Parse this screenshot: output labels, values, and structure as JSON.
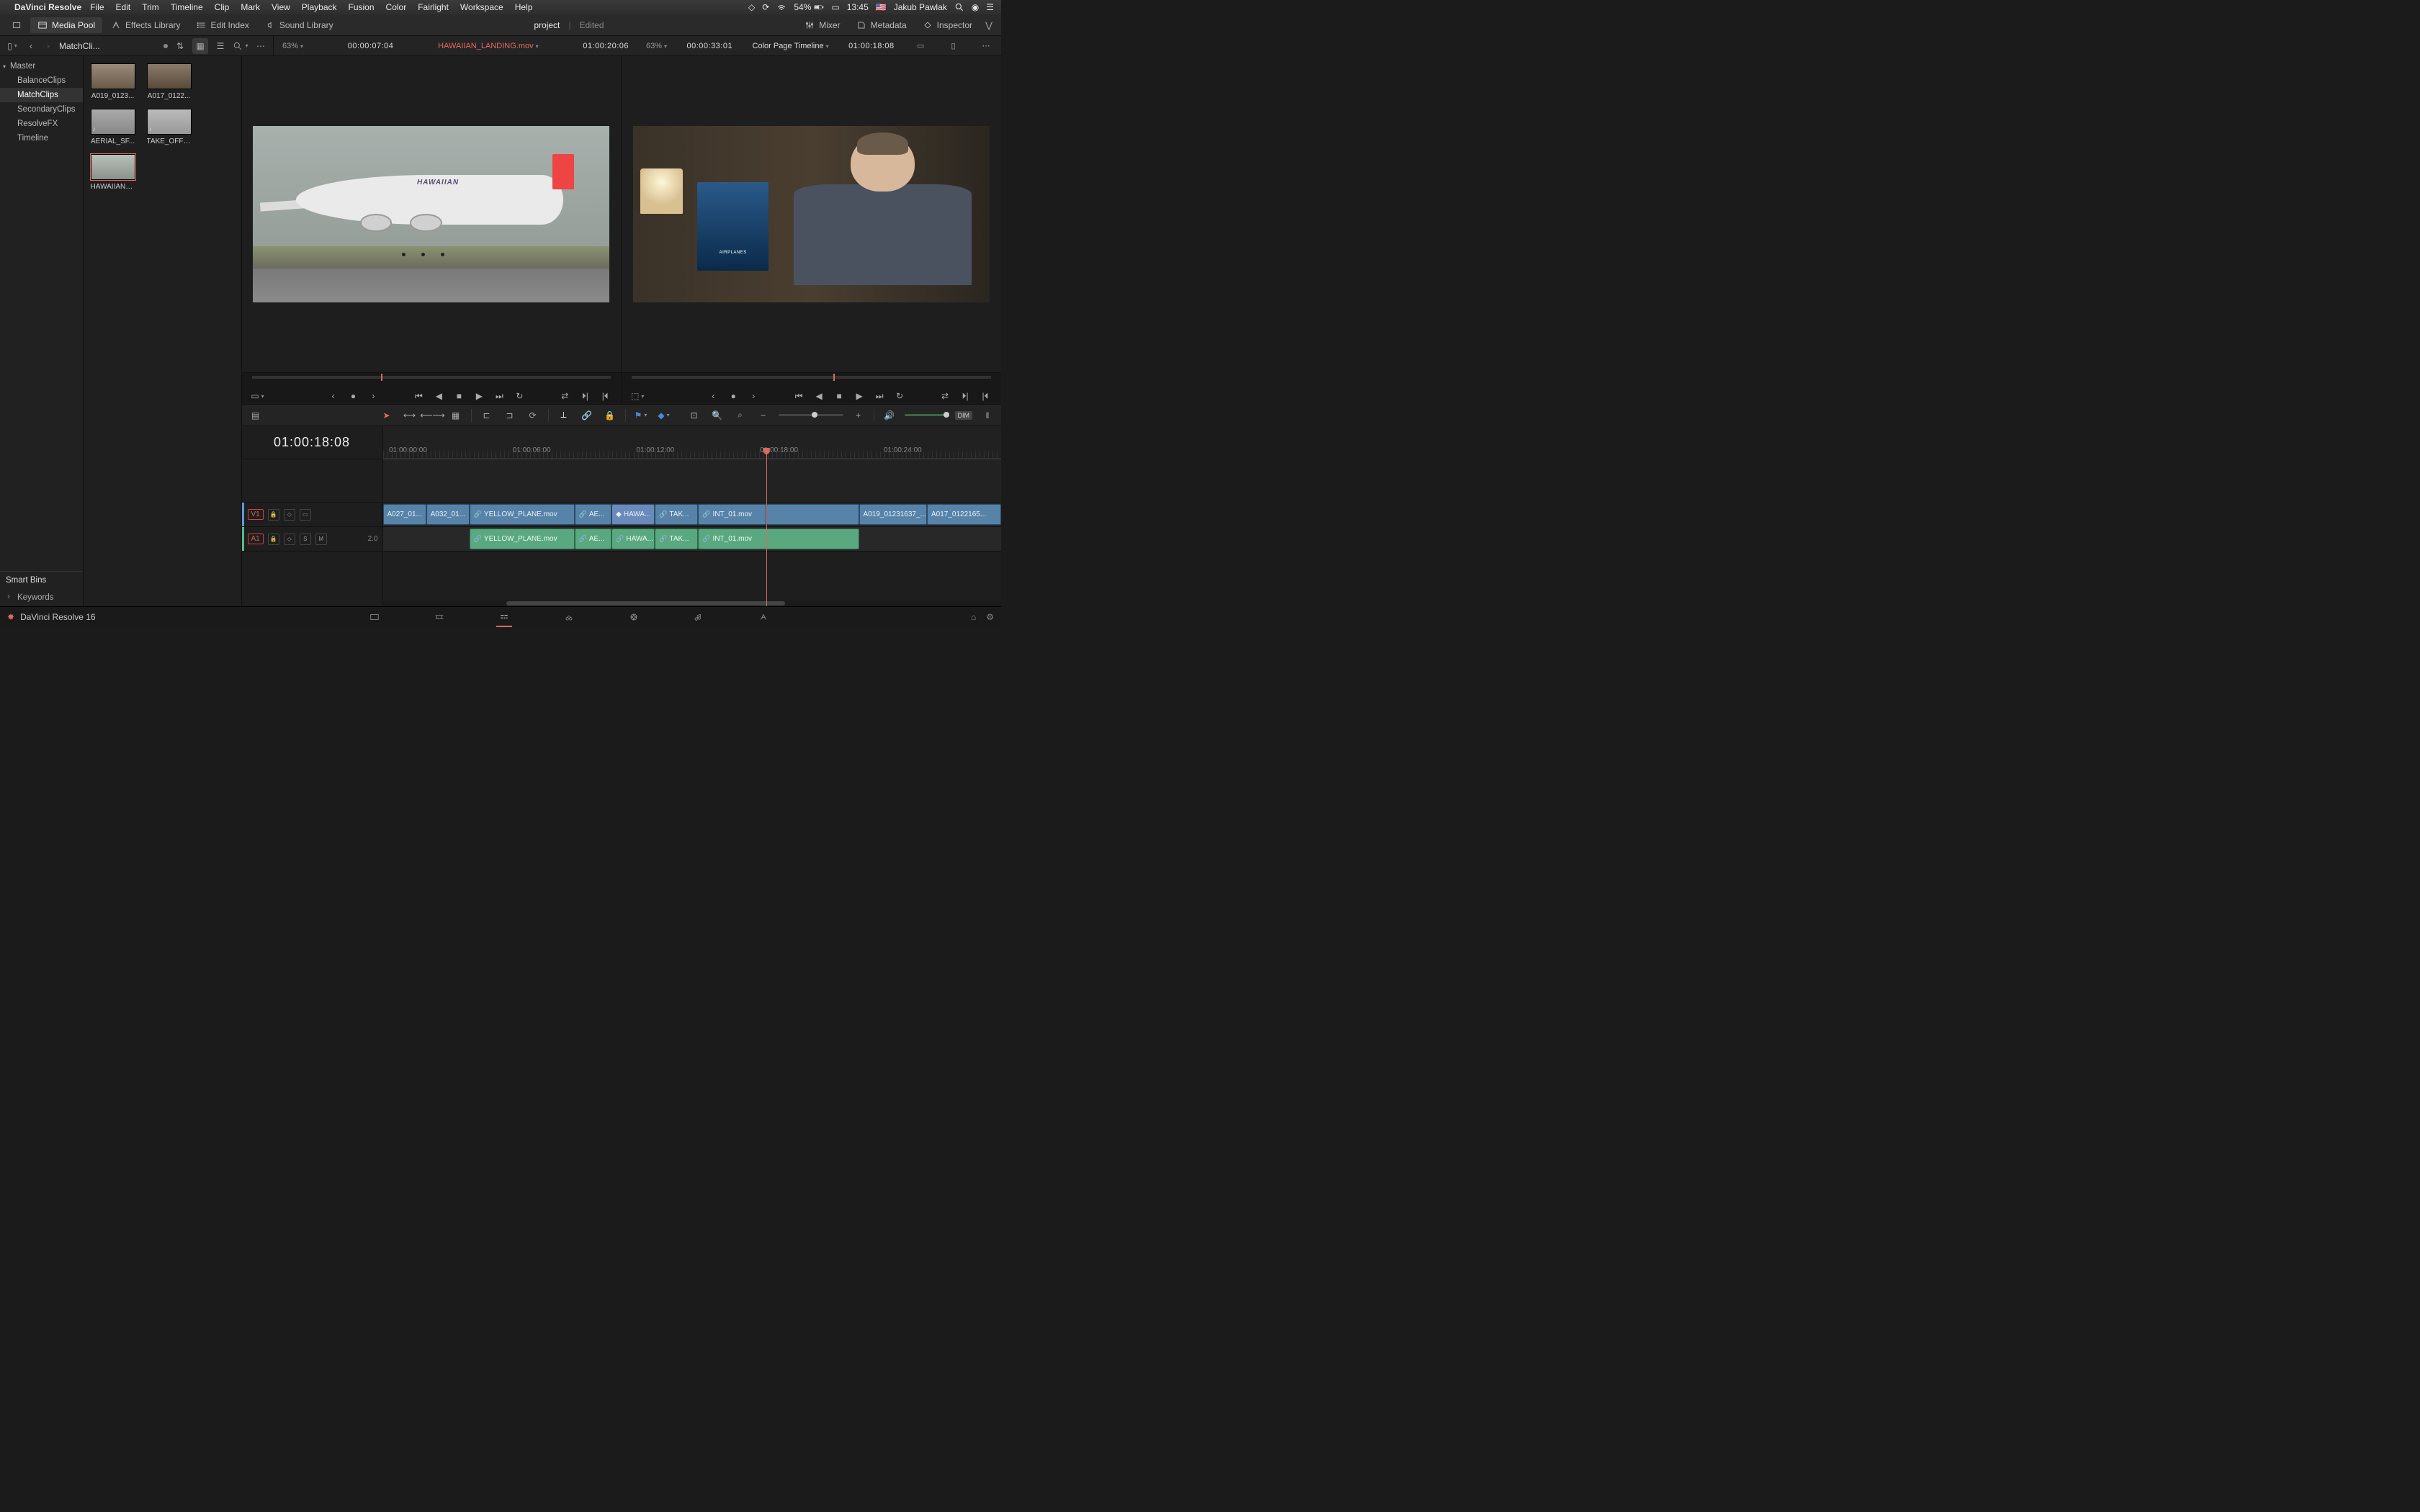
{
  "mac_menu": {
    "app_name": "DaVinci Resolve",
    "items": [
      "File",
      "Edit",
      "Trim",
      "Timeline",
      "Clip",
      "Mark",
      "View",
      "Playback",
      "Fusion",
      "Color",
      "Fairlight",
      "Workspace",
      "Help"
    ],
    "battery": "54%",
    "time": "13:45",
    "user": "Jakub Pawlak",
    "flag": "🇺🇸"
  },
  "toolbar": {
    "media_pool": "Media Pool",
    "effects_lib": "Effects Library",
    "edit_index": "Edit Index",
    "sound_lib": "Sound Library",
    "project": "project",
    "edited": "Edited",
    "mixer": "Mixer",
    "metadata": "Metadata",
    "inspector": "Inspector"
  },
  "secondary": {
    "breadcrumb": "MatchCli...",
    "source": {
      "zoom": "63%",
      "tc": "00:00:07:04",
      "clip": "HAWAIIAN_LANDING.mov",
      "dur": "01:00:20:06"
    },
    "timeline": {
      "zoom": "63%",
      "tc": "00:00:33:01",
      "name": "Color Page Timeline",
      "pos": "01:00:18:08"
    }
  },
  "bins": {
    "master": "Master",
    "children": [
      "BalanceClips",
      "MatchClips",
      "SecondaryClips",
      "ResolveFX",
      "Timeline"
    ],
    "selected": "MatchClips",
    "smart_bins_label": "Smart Bins",
    "smart_bins": [
      "Keywords"
    ]
  },
  "clips": [
    {
      "name": "A019_0123..."
    },
    {
      "name": "A017_0122..."
    },
    {
      "name": "AERIAL_SF...",
      "audio": true
    },
    {
      "name": "TAKE_OFF_...",
      "audio": true
    },
    {
      "name": "HAWAIIAN_...",
      "sel": true
    }
  ],
  "viewer_decor": {
    "hawaiian": "HAWAIIAN",
    "poster": "AIRPLANES"
  },
  "timeline_tc": "01:00:18:08",
  "ruler": [
    "01:00:00:00",
    "01:00:06:00",
    "01:00:12:00",
    "01:00:18:00",
    "01:00:24:00"
  ],
  "playhead_pct": 62,
  "tracks": {
    "v1": {
      "label": "V1",
      "clips": [
        {
          "l": 0,
          "w": 7,
          "label": "A027_01..."
        },
        {
          "l": 7,
          "w": 7,
          "label": "A032_01..."
        },
        {
          "l": 14,
          "w": 17,
          "label": "YELLOW_PLANE.mov",
          "link": true
        },
        {
          "l": 31,
          "w": 6,
          "label": "AE...",
          "link": true
        },
        {
          "l": 37,
          "w": 7,
          "label": "HAWA...",
          "fx": true
        },
        {
          "l": 44,
          "w": 7,
          "label": "TAK...",
          "link": true
        },
        {
          "l": 51,
          "w": 11,
          "label": "INT_01.mov",
          "link": true
        },
        {
          "l": 62,
          "w": 15,
          "label": ""
        },
        {
          "l": 77,
          "w": 11,
          "label": "A019_01231637_..."
        },
        {
          "l": 88,
          "w": 12,
          "label": "A017_0122165..."
        }
      ]
    },
    "a1": {
      "label": "A1",
      "channels": "2.0",
      "clips": [
        {
          "l": 14,
          "w": 17,
          "label": "YELLOW_PLANE.mov",
          "link": true
        },
        {
          "l": 31,
          "w": 6,
          "label": "AE...",
          "link": true
        },
        {
          "l": 37,
          "w": 7,
          "label": "HAWA...",
          "link": true
        },
        {
          "l": 44,
          "w": 7,
          "label": "TAK...",
          "link": true
        },
        {
          "l": 51,
          "w": 26,
          "label": "INT_01.mov",
          "link": true
        }
      ]
    }
  },
  "tl_tools": {
    "dim": "DIM"
  },
  "bottom": {
    "app_version": "DaVinci Resolve 16"
  }
}
